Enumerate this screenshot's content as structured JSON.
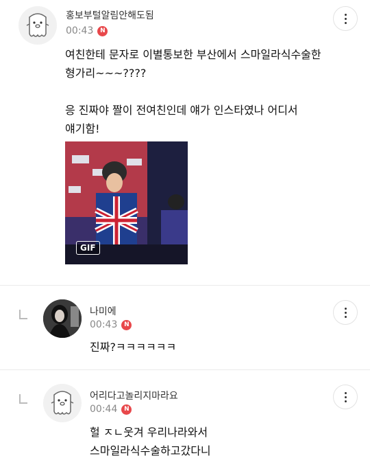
{
  "comments": [
    {
      "nickname": "홍보부털알림안해도됨",
      "time": "00:43",
      "badge": "N",
      "avatar_icon": "ghost-mascot-icon",
      "text": "여친한테 문자로 이별통보한 부산에서 스마일라식수술한\n형가리~~~????\n\n응 진짜야 짤이 전여친인데 얘가 인스타였나 어디서\n얘기함!",
      "attachment": {
        "type": "gif",
        "badge": "GIF"
      }
    },
    {
      "nickname": "나미에",
      "time": "00:43",
      "badge": "N",
      "avatar_icon": "profile-photo",
      "text": "진짜?ㅋㅋㅋㅋㅋㅋ"
    },
    {
      "nickname": "어리다고놀리지마라요",
      "time": "00:44",
      "badge": "N",
      "avatar_icon": "ghost-mascot-icon",
      "text": "헐 ㅈㄴ웃겨 우리나라와서\n스마일라식수술하고갔다니"
    }
  ],
  "colors": {
    "badge_red": "#e8484b",
    "divider": "#eaeaea",
    "time_gray": "#888888"
  }
}
